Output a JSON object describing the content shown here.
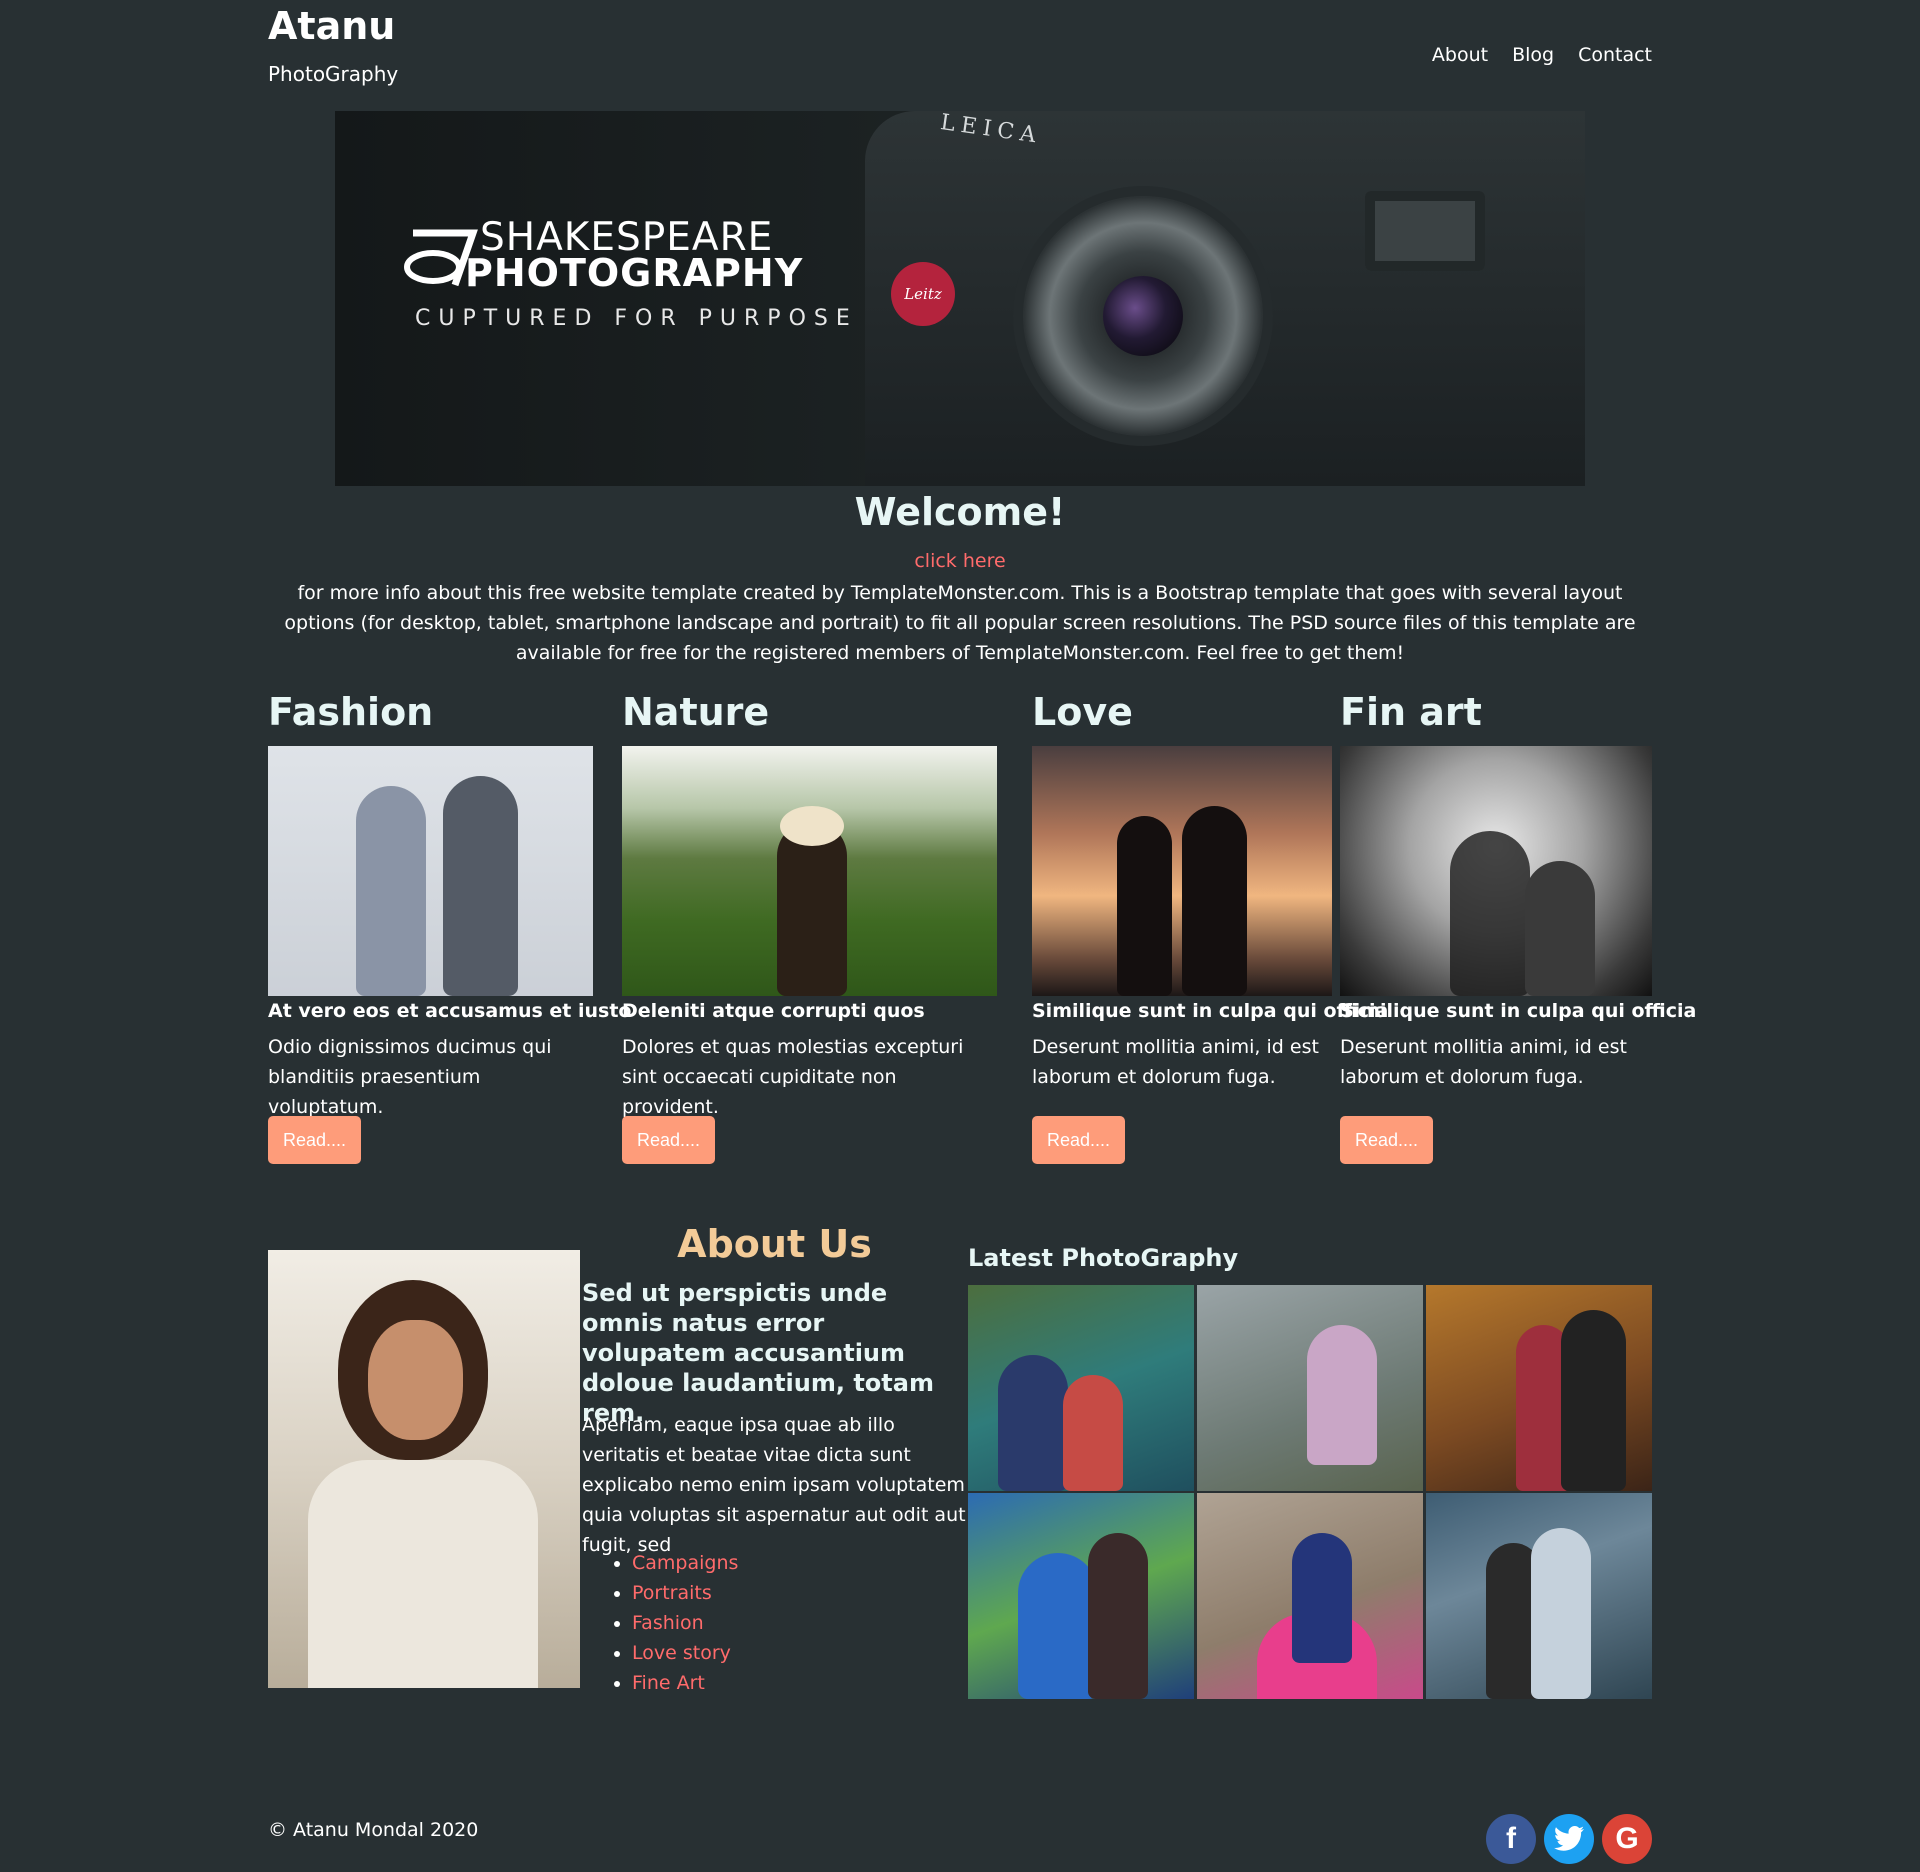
{
  "header": {
    "brand_title": "Atanu",
    "brand_subtitle": "PhotoGraphy",
    "nav": [
      "About",
      "Blog",
      "Contact"
    ]
  },
  "hero": {
    "camera_brand": "LEICA",
    "lens_label": "Leitz",
    "logo_line1": "SHAKESPEARE",
    "logo_line2": "PHOTOGRAPHY",
    "tagline": "CUPTURED FOR PURPOSE"
  },
  "welcome": {
    "title": "Welcome!",
    "link": "click here",
    "text": "for more info about this free website template created by TemplateMonster.com. This is a Bootstrap template that goes with several layout options (for desktop, tablet, smartphone landscape and portrait) to fit all popular screen resolutions. The PSD source files of this template are available for free for the registered members of TemplateMonster.com. Feel free to get them!"
  },
  "categories": [
    {
      "title": "Fashion",
      "heading": "At vero eos et accusamus et iusto",
      "text": "Odio dignissimos ducimus qui blanditiis praesentium voluptatum.",
      "button": "Read...."
    },
    {
      "title": "Nature",
      "heading": "Deleniti atque corrupti quos",
      "text": "Dolores et quas molestias excepturi sint occaecati cupiditate non provident.",
      "button": "Read...."
    },
    {
      "title": "Love",
      "heading": "Similique sunt in culpa qui officia",
      "text": "Deserunt mollitia animi, id est laborum et dolorum fuga.",
      "button": "Read...."
    },
    {
      "title": "Fin art",
      "heading": "Similique sunt in culpa qui officia",
      "text": "Deserunt mollitia animi, id est laborum et dolorum fuga.",
      "button": "Read...."
    }
  ],
  "about": {
    "title": "About Us",
    "lead": "Sed ut perspictis unde omnis natus error volupatem accusantium doloue laudantium, totam rem.",
    "text": "Aperiam, eaque ipsa quae ab illo veritatis et beatae vitae dicta sunt explicabo nemo enim ipsam voluptatem quia voluptas sit aspernatur aut odit aut fugit, sed",
    "list": [
      "Campaigns",
      "Portraits",
      "Fashion",
      "Love story",
      "Fine Art"
    ]
  },
  "latest": {
    "title": "Latest PhotoGraphy"
  },
  "footer": {
    "copyright": "© Atanu Mondal 2020",
    "social": [
      {
        "icon": "facebook-icon",
        "glyph": "f",
        "color": "#3b5998"
      },
      {
        "icon": "twitter-icon",
        "glyph": "t",
        "color": "#1da1f2"
      },
      {
        "icon": "google-icon",
        "glyph": "G",
        "color": "#db4437"
      }
    ]
  },
  "colors": {
    "background": "#283033",
    "accent_link": "#ff6b6b",
    "button": "#fe9c7a",
    "about_title": "#f3cb98",
    "heading": "#e7f6f5"
  }
}
